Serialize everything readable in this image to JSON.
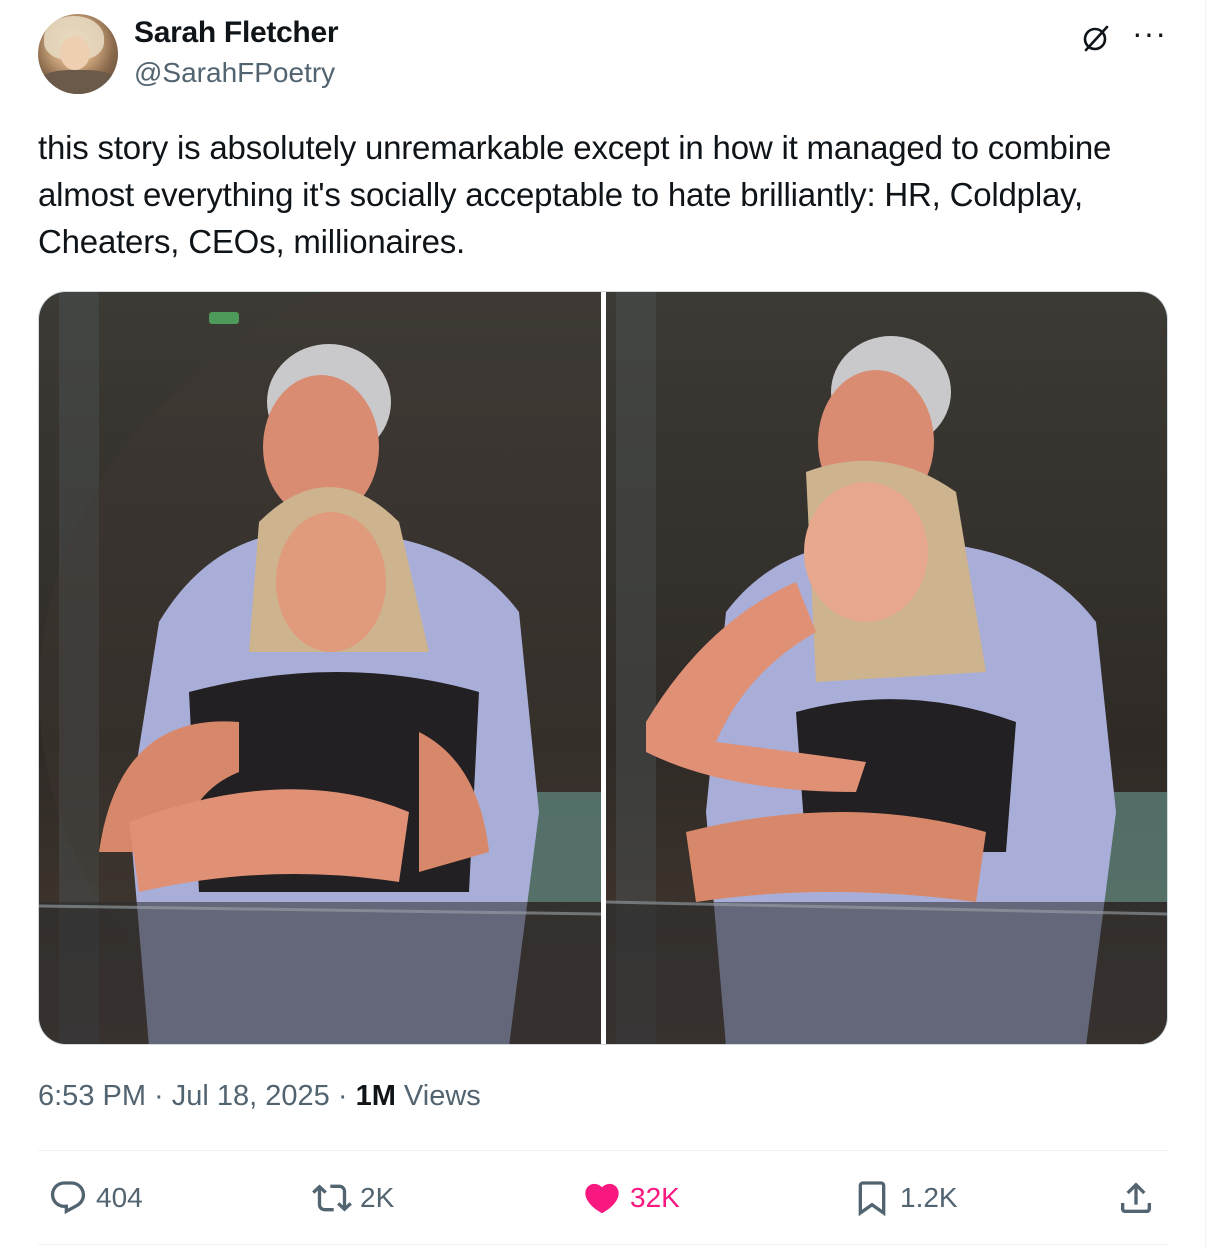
{
  "author": {
    "name": "Sarah Fletcher",
    "handle": "@SarahFPoetry",
    "avatar": "avatar"
  },
  "header_icons": [
    "grok-icon",
    "more-icon"
  ],
  "more_label": "···",
  "tweet": {
    "text": "this story is absolutely unremarkable except in how it managed to combine almost everything it's socially acceptable to hate brilliantly: HR, Coldplay, Cheaters, CEOs, millionaires."
  },
  "media": {
    "count": 2,
    "alt": [
      "photo-left",
      "photo-right"
    ]
  },
  "meta": {
    "time": "6:53 PM",
    "separator": " · ",
    "date": "Jul 18, 2025",
    "views_count": "1M",
    "views_label": " Views"
  },
  "actions": {
    "reply": {
      "icon": "reply-icon",
      "count": "404"
    },
    "repost": {
      "icon": "repost-icon",
      "count": "2K"
    },
    "like": {
      "icon": "heart-icon",
      "count": "32K",
      "color": "#f91880"
    },
    "bookmark": {
      "icon": "bookmark-icon",
      "count": "1.2K"
    },
    "share": {
      "icon": "share-icon"
    }
  },
  "colors": {
    "text_primary": "#0f1419",
    "text_secondary": "#536471",
    "like": "#f91880",
    "border": "#eff3f4"
  }
}
